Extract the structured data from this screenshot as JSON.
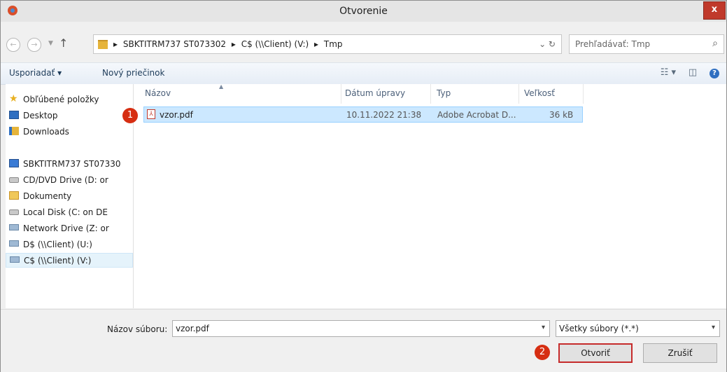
{
  "window": {
    "title": "Otvorenie",
    "close_label": "x"
  },
  "nav": {
    "back_glyph": "←",
    "forward_glyph": "→",
    "history_glyph": "▼",
    "up_glyph": "↑",
    "breadcrumb": [
      "SBKTITRM737 ST073302",
      "C$ (\\\\Client) (V:)",
      "Tmp"
    ],
    "separator": "▸",
    "refresh_glyph": "⌄   ↻",
    "search_placeholder": "Prehľadávať: Tmp",
    "search_glyph": "⌕"
  },
  "toolbar": {
    "organize_label": "Usporiadať ▾",
    "new_folder_label": "Nový priečinok",
    "view_glyph": "☷ ▾",
    "pane_glyph": "◫",
    "help_glyph": "?"
  },
  "sidebar": {
    "items": [
      {
        "label": "Obľúbené položky",
        "icon": "star-icon"
      },
      {
        "label": "Desktop",
        "icon": "desktop-icon"
      },
      {
        "label": "Downloads",
        "icon": "downloads-icon"
      },
      {
        "label": "SBKTITRM737 ST07330",
        "icon": "computer-icon"
      },
      {
        "label": "CD/DVD Drive (D: or",
        "icon": "cd-drive-icon"
      },
      {
        "label": "Dokumenty",
        "icon": "folder-icon"
      },
      {
        "label": "Local Disk (C: on DE",
        "icon": "disk-icon"
      },
      {
        "label": "Network Drive (Z: or",
        "icon": "network-drive-icon"
      },
      {
        "label": "D$ (\\\\Client) (U:)",
        "icon": "network-drive-icon"
      },
      {
        "label": "C$ (\\\\Client) (V:)",
        "icon": "network-drive-icon"
      }
    ]
  },
  "columns": {
    "name": "Názov",
    "modified": "Dátum úpravy",
    "type": "Typ",
    "size": "Veľkosť",
    "sort_glyph": "▲"
  },
  "files": [
    {
      "name": "vzor.pdf",
      "modified": "10.11.2022 21:38",
      "type": "Adobe Acrobat D...",
      "size": "36 kB",
      "icon": "pdf-icon"
    }
  ],
  "markers": {
    "first": "1",
    "second": "2"
  },
  "footer": {
    "filename_label": "Názov súboru:",
    "filename_value": "vzor.pdf",
    "filter_value": "Všetky súbory (*.*)",
    "dropdown_glyph": "▾",
    "open_label": "Otvoriť",
    "cancel_label": "Zrušiť"
  },
  "colors": {
    "accent": "#2f6fc1",
    "selection": "#cce8ff",
    "marker": "#d62e12",
    "close": "#c0392b"
  }
}
